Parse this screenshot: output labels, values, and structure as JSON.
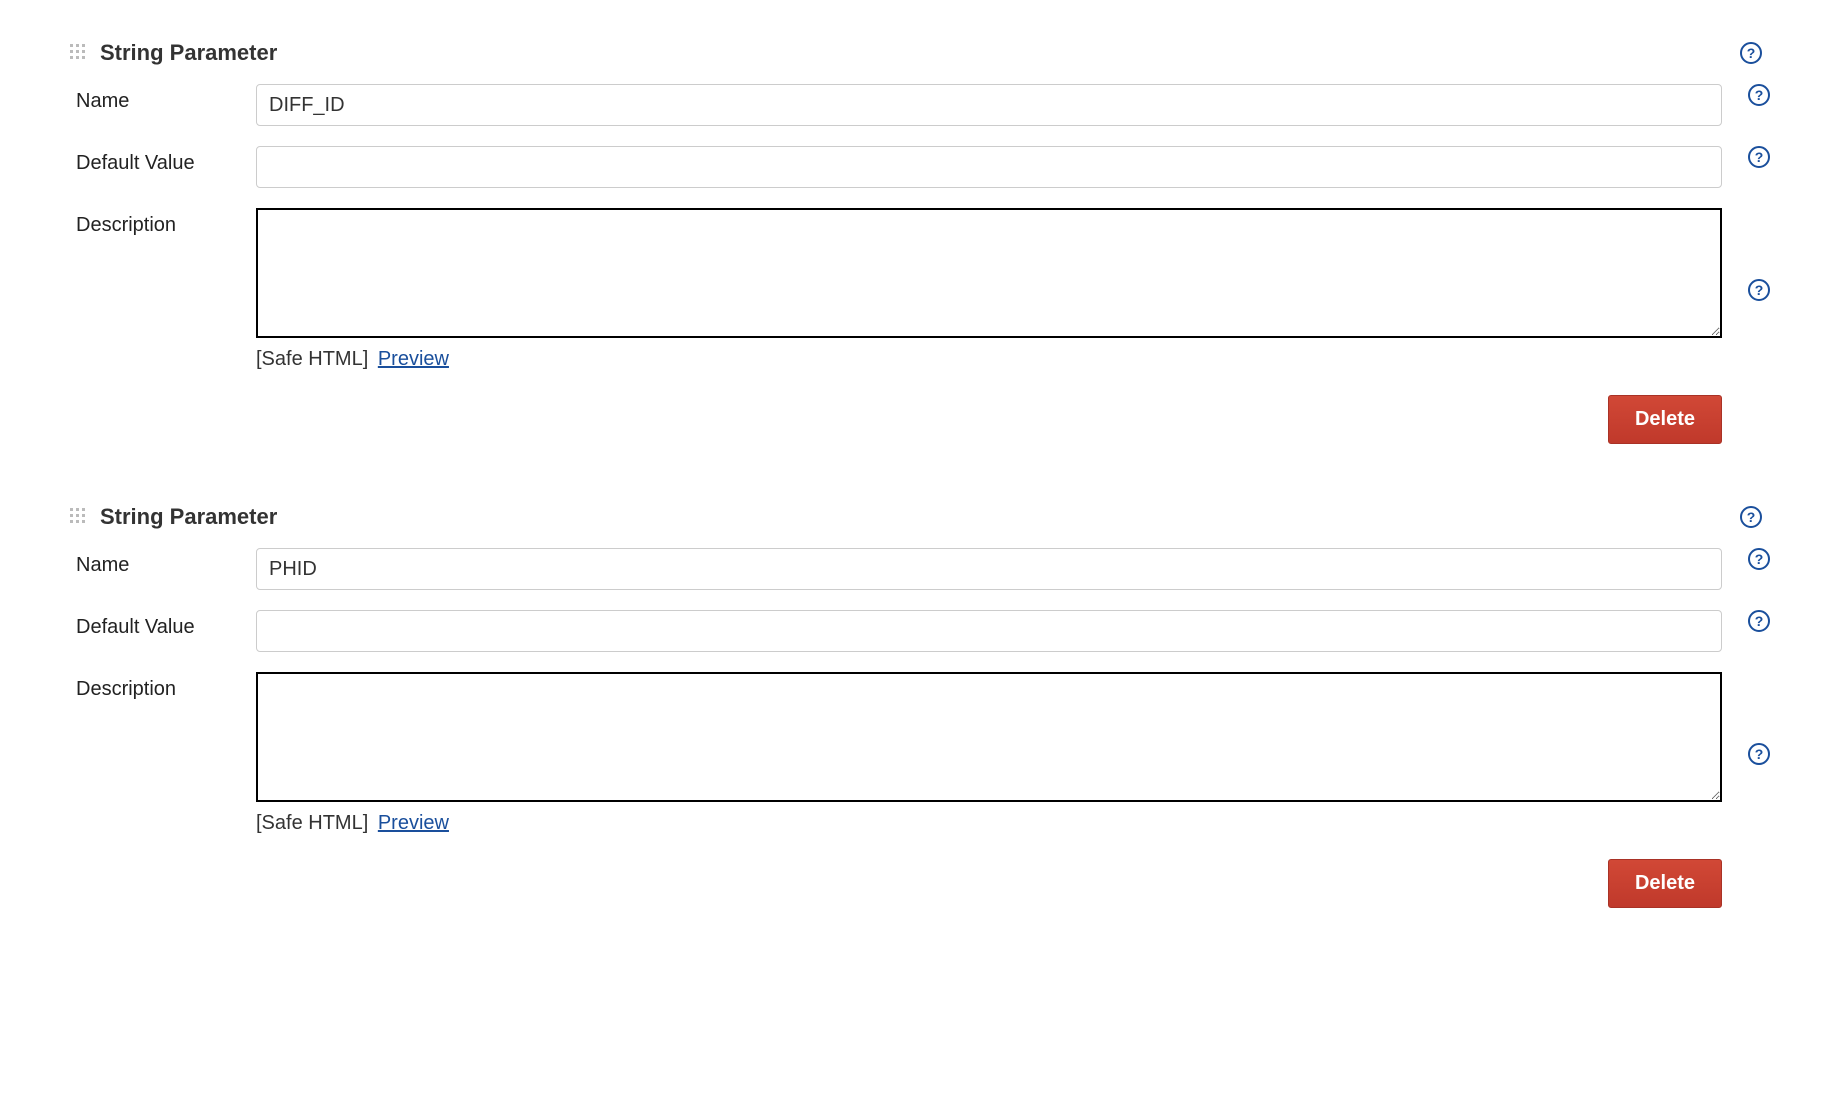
{
  "parameters": [
    {
      "type_label": "String Parameter",
      "name_label": "Name",
      "name_value": "DIFF_ID",
      "default_label": "Default Value",
      "default_value": "",
      "description_label": "Description",
      "description_value": "",
      "hint_bracket": "[Safe HTML]",
      "preview_label": "Preview",
      "delete_label": "Delete"
    },
    {
      "type_label": "String Parameter",
      "name_label": "Name",
      "name_value": "PHID",
      "default_label": "Default Value",
      "default_value": "",
      "description_label": "Description",
      "description_value": "",
      "hint_bracket": "[Safe HTML]",
      "preview_label": "Preview",
      "delete_label": "Delete"
    }
  ]
}
